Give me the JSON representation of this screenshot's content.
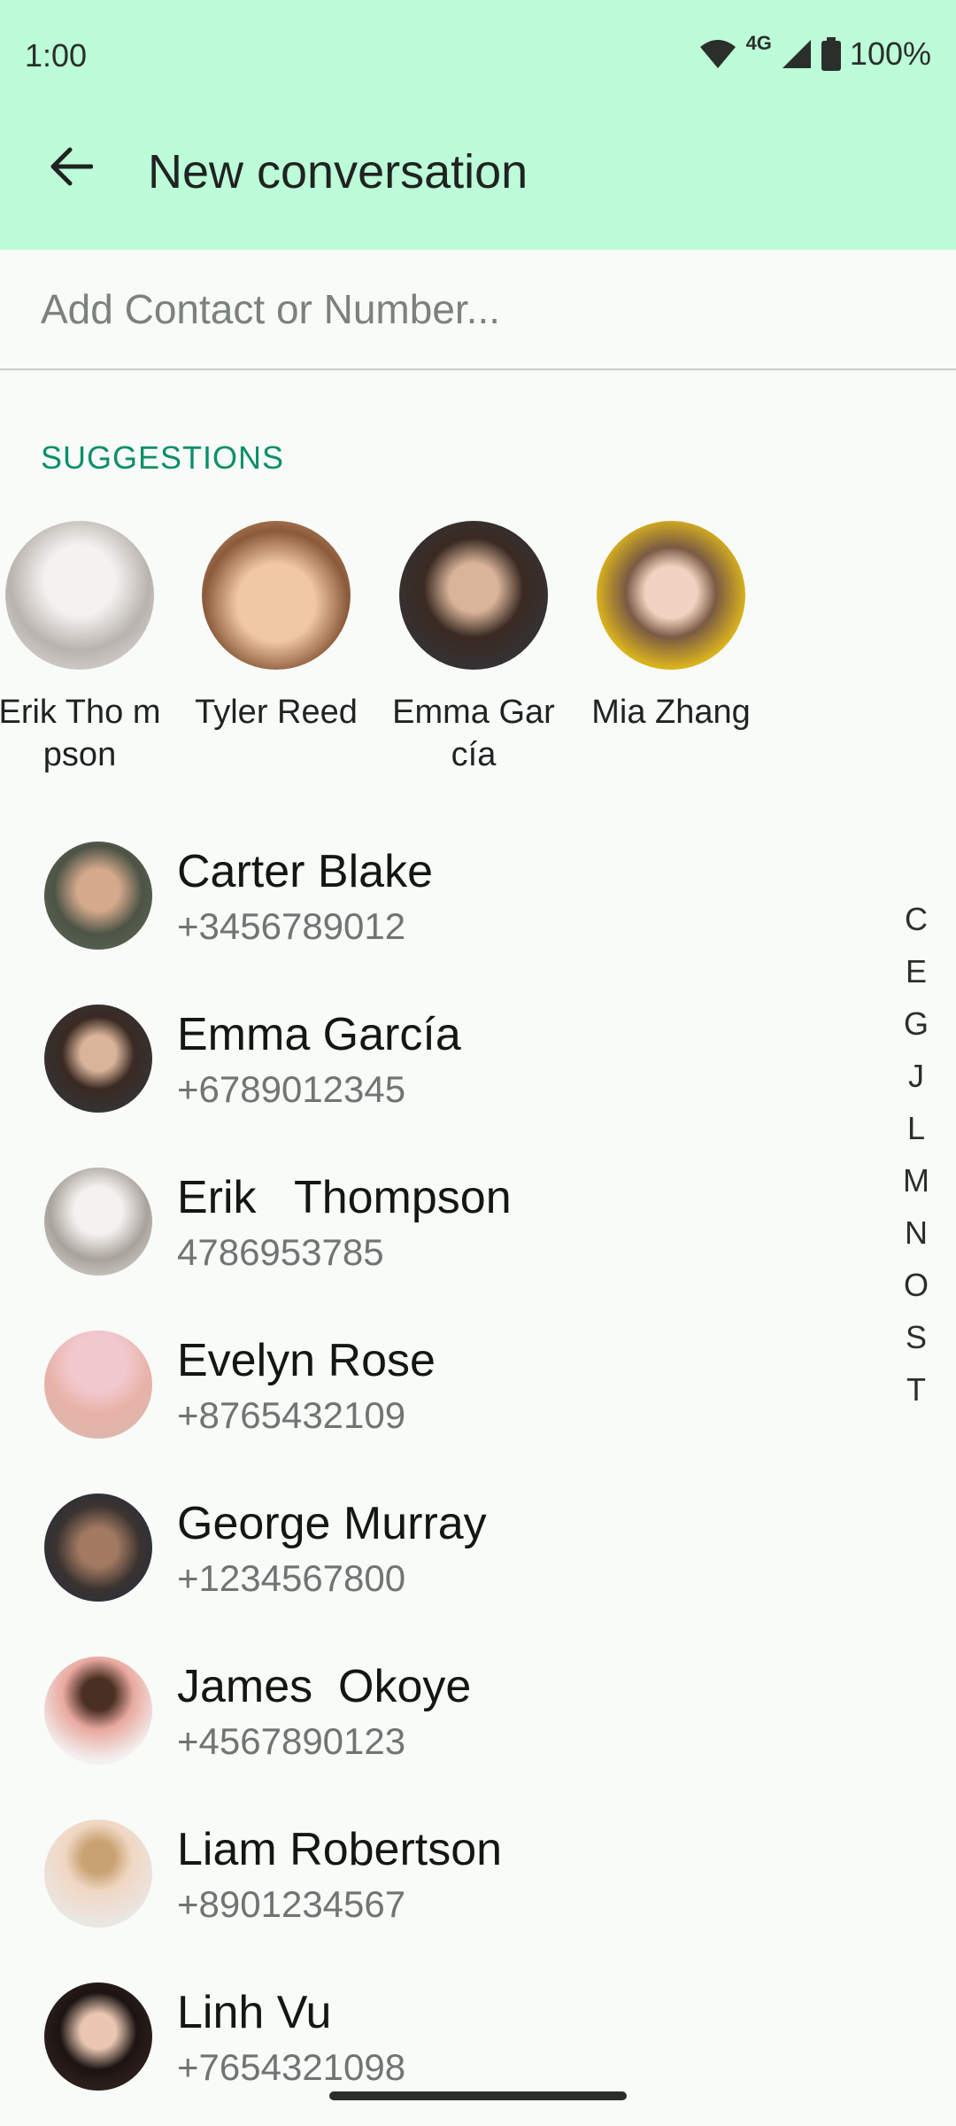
{
  "status_bar": {
    "time": "1:00",
    "network": "4G",
    "battery": "100%"
  },
  "header": {
    "back_icon": "arrow-back-icon",
    "title": "New conversation"
  },
  "search": {
    "placeholder": "Add Contact or Number..."
  },
  "suggestions_label": "SUGGESTIONS",
  "suggestions": [
    {
      "name": "Erik Tho mpson",
      "avatar_color": "#e7e4e2"
    },
    {
      "name": "Tyler Reed",
      "avatar_color": "#d8a27c"
    },
    {
      "name": "Emma García",
      "avatar_color": "#2f3a44"
    },
    {
      "name": "Mia Zhang",
      "avatar_color": "#d9b21e"
    }
  ],
  "contacts": [
    {
      "name": "Carter Blake",
      "phone": "+3456789012",
      "avatar_color": "#5f6a59"
    },
    {
      "name": "Emma García",
      "phone": "+6789012345",
      "avatar_color": "#2f3a44"
    },
    {
      "name": "Erik   Thompson",
      "phone": "4786953785",
      "avatar_color": "#cfcac6"
    },
    {
      "name": "Evelyn Rose",
      "phone": "+8765432109",
      "avatar_color": "#e5b7b8"
    },
    {
      "name": "George Murray",
      "phone": "+1234567800",
      "avatar_color": "#3b3330"
    },
    {
      "name": "James  Okoye",
      "phone": "+4567890123",
      "avatar_color": "#e9a9a0"
    },
    {
      "name": "Liam Robertson",
      "phone": "+8901234567",
      "avatar_color": "#eae6e2"
    },
    {
      "name": "Linh Vu",
      "phone": "+7654321098",
      "avatar_color": "#3d2b24"
    }
  ],
  "alphabet_index": [
    "C",
    "E",
    "G",
    "J",
    "L",
    "M",
    "N",
    "O",
    "S",
    "T"
  ],
  "colors": {
    "top_bar": "#bdfcd8",
    "background": "#f8fbf8",
    "accent": "#0b8f6a"
  }
}
